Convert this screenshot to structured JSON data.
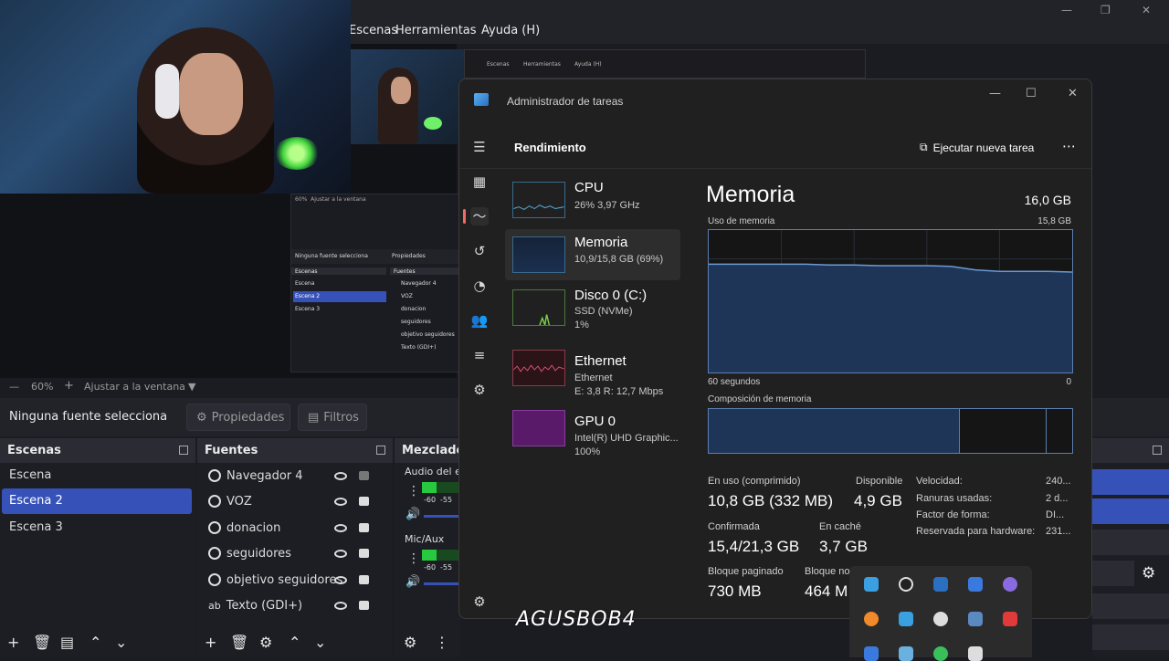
{
  "obs": {
    "menu": [
      "Escenas",
      "Herramientas",
      "Ayuda (H)"
    ],
    "zoom": {
      "percent": "60%",
      "fit_label": "Ajustar a la ventana"
    },
    "no_source": "Ninguna fuente selecciona",
    "properties_label": "Propiedades",
    "filters_label": "Filtros",
    "scenes": {
      "title": "Escenas",
      "items": [
        "Escena",
        "Escena 2",
        "Escena 3"
      ],
      "selected": "Escena 2"
    },
    "sources": {
      "title": "Fuentes",
      "items": [
        "Navegador 4",
        "VOZ",
        "donacion",
        "seguidores",
        "objetivo seguidores",
        "Texto (GDI+)"
      ]
    },
    "mixer": {
      "title": "Mezclador",
      "channels": [
        {
          "label": "Audio del es",
          "ticks": [
            "-60",
            "-55"
          ]
        },
        {
          "label": "Mic/Aux",
          "ticks": [
            "-60",
            "-55"
          ]
        }
      ]
    }
  },
  "nested_obs": {
    "no_source": "Ninguna fuente selecciona",
    "properties": "Propiedades",
    "scenes_title": "Escenas",
    "sources_title": "Fuentes",
    "scenes": [
      "Escena",
      "Escena 2",
      "Escena 3"
    ],
    "sources": [
      "Navegador 4",
      "VOZ",
      "donacion",
      "seguidores",
      "objetivo seguidores",
      "Texto (GDI+)"
    ],
    "zoom": "60%",
    "fit": "Ajustar a la ventana"
  },
  "nested_tm_menu": [
    "Escenas",
    "Herramientas",
    "Ayuda (H)"
  ],
  "taskmgr": {
    "title": "Administrador de tareas",
    "header": "Rendimiento",
    "run_task": "Ejecutar nueva tarea",
    "perf_items": [
      {
        "name": "CPU",
        "sub1": "26%  3,97 GHz",
        "sub2": ""
      },
      {
        "name": "Memoria",
        "sub1": "10,9/15,8 GB (69%)",
        "sub2": ""
      },
      {
        "name": "Disco 0 (C:)",
        "sub1": "SSD (NVMe)",
        "sub2": "1%"
      },
      {
        "name": "Ethernet",
        "sub1": "Ethernet",
        "sub2": "E: 3,8  R: 12,7 Mbps"
      },
      {
        "name": "GPU 0",
        "sub1": "Intel(R) UHD Graphic...",
        "sub2": "100%"
      }
    ],
    "memory": {
      "title": "Memoria",
      "total": "16,0 GB",
      "usage_label": "Uso de memoria",
      "usage_max": "15,8 GB",
      "time_label": "60 segundos",
      "time_end": "0",
      "composition_label": "Composición de memoria",
      "usage_fraction_series": [
        0.76,
        0.76,
        0.76,
        0.76,
        0.76,
        0.755,
        0.755,
        0.75,
        0.75,
        0.75,
        0.745,
        0.72,
        0.71,
        0.71,
        0.71,
        0.705
      ],
      "composition": {
        "in_use": 0.69,
        "modified": 0.24,
        "standby": 0.07
      },
      "stats": [
        {
          "label": "En uso (comprimido)",
          "value": "10,8 GB (332 MB)"
        },
        {
          "label": "Disponible",
          "value": "4,9 GB"
        },
        {
          "label": "Confirmada",
          "value": "15,4/21,3 GB"
        },
        {
          "label": "En caché",
          "value": "3,7 GB"
        },
        {
          "label": "Bloque paginado",
          "value": "730 MB"
        },
        {
          "label": "Bloque no",
          "value": "464 M"
        }
      ],
      "side": [
        {
          "label": "Velocidad:",
          "value": "240..."
        },
        {
          "label": "Ranuras usadas:",
          "value": "2 d..."
        },
        {
          "label": "Factor de forma:",
          "value": "DI..."
        },
        {
          "label": "Reservada para hardware:",
          "value": "231..."
        }
      ]
    }
  },
  "watermark": "AGUSBOB4",
  "colors": {
    "accent": "#3652b8",
    "tm_bg": "#202020",
    "graph_border": "#5b7fb0"
  }
}
